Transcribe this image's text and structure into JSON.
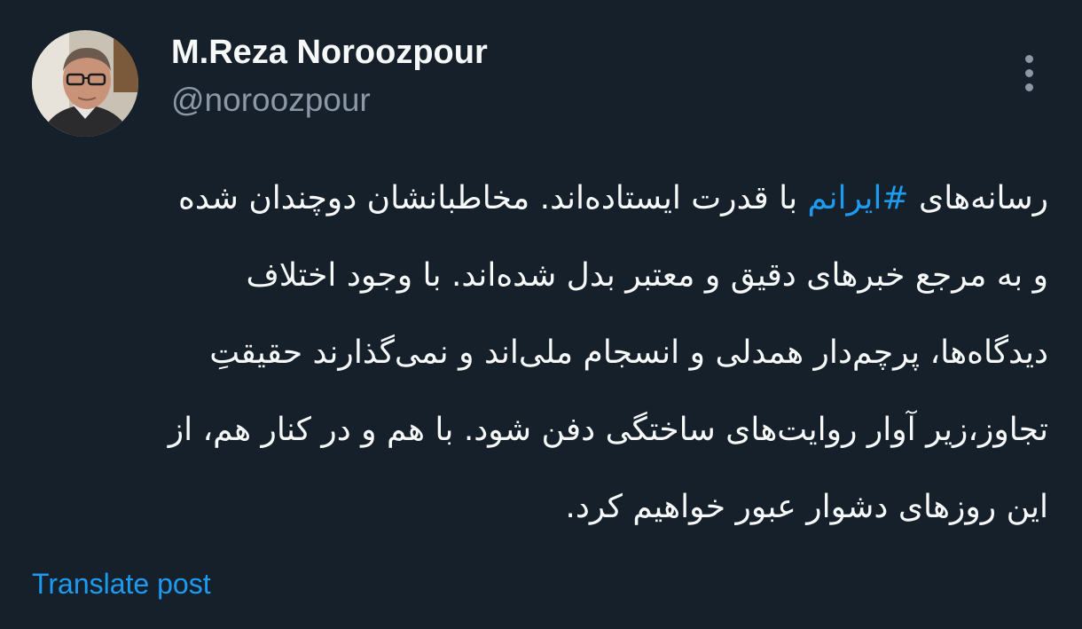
{
  "author": {
    "display_name": "M.Reza Noroozpour",
    "handle": "@noroozpour",
    "avatar_icon": "profile-photo"
  },
  "menu": {
    "icon": "more-options-icon"
  },
  "post": {
    "line1_before": "رسانه‌های ",
    "hashtag": "#ایرانم",
    "line1_after": " با قدرت ایستاده‌اند. مخاطبانشان دوچندان شده",
    "line2": "و به مرجع خبرهای دقیق و معتبر بدل شده‌اند. با وجود اختلاف",
    "line3": "دیدگاه‌ها، پرچم‌دار همدلی و انسجام ملی‌اند و نمی‌گذارند حقیقتِ",
    "line4": "تجاوز،زیر آوار روایت‌های ساختگی دفن شود. با هم و در کنار هم، از",
    "line5": "این روزهای دشوار عبور خواهیم کرد."
  },
  "actions": {
    "translate_label": "Translate post"
  },
  "colors": {
    "background": "#15202b",
    "text": "#f7f9f9",
    "secondary": "#8b98a5",
    "link": "#1d9bf0"
  }
}
